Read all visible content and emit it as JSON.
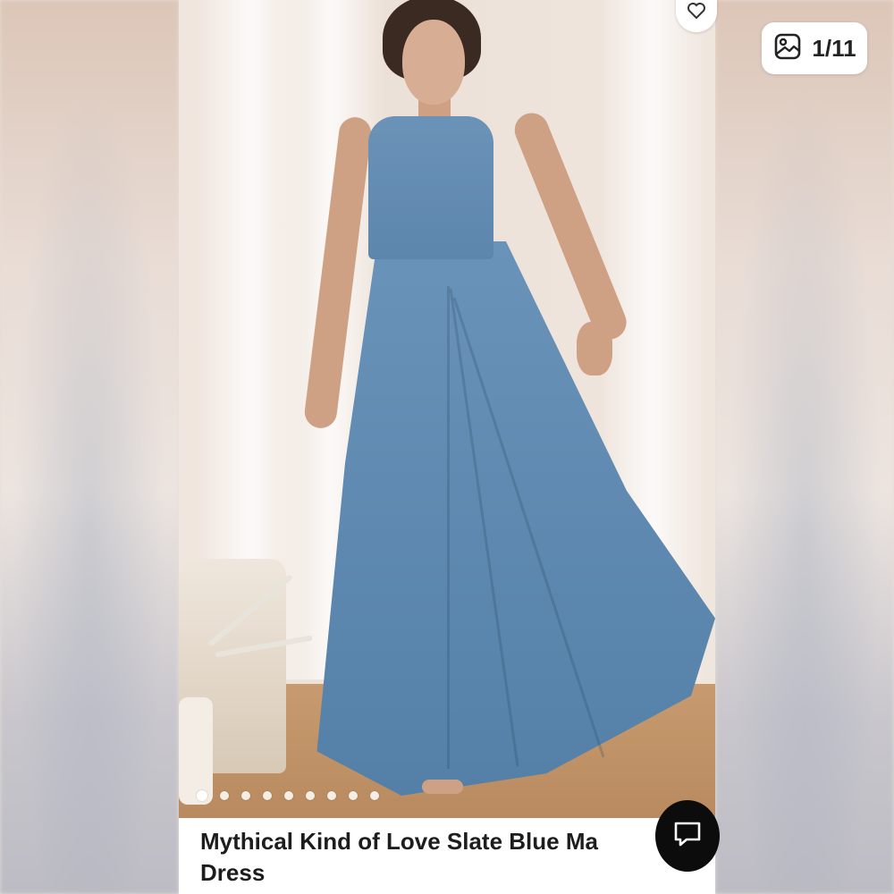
{
  "image_counter": {
    "text": "1/11"
  },
  "product": {
    "title_line1": "Mythical Kind of Love Slate Blue Ma",
    "title_line2": "Dress"
  },
  "carousel": {
    "dot_count": 9,
    "active_index": 0
  },
  "icons": {
    "gallery": "image-gallery-icon",
    "favorite": "heart-icon",
    "chat": "chat-bubble-icon"
  },
  "colors": {
    "dress": "#6a93b9",
    "chat_button": "#0c0c0c"
  }
}
